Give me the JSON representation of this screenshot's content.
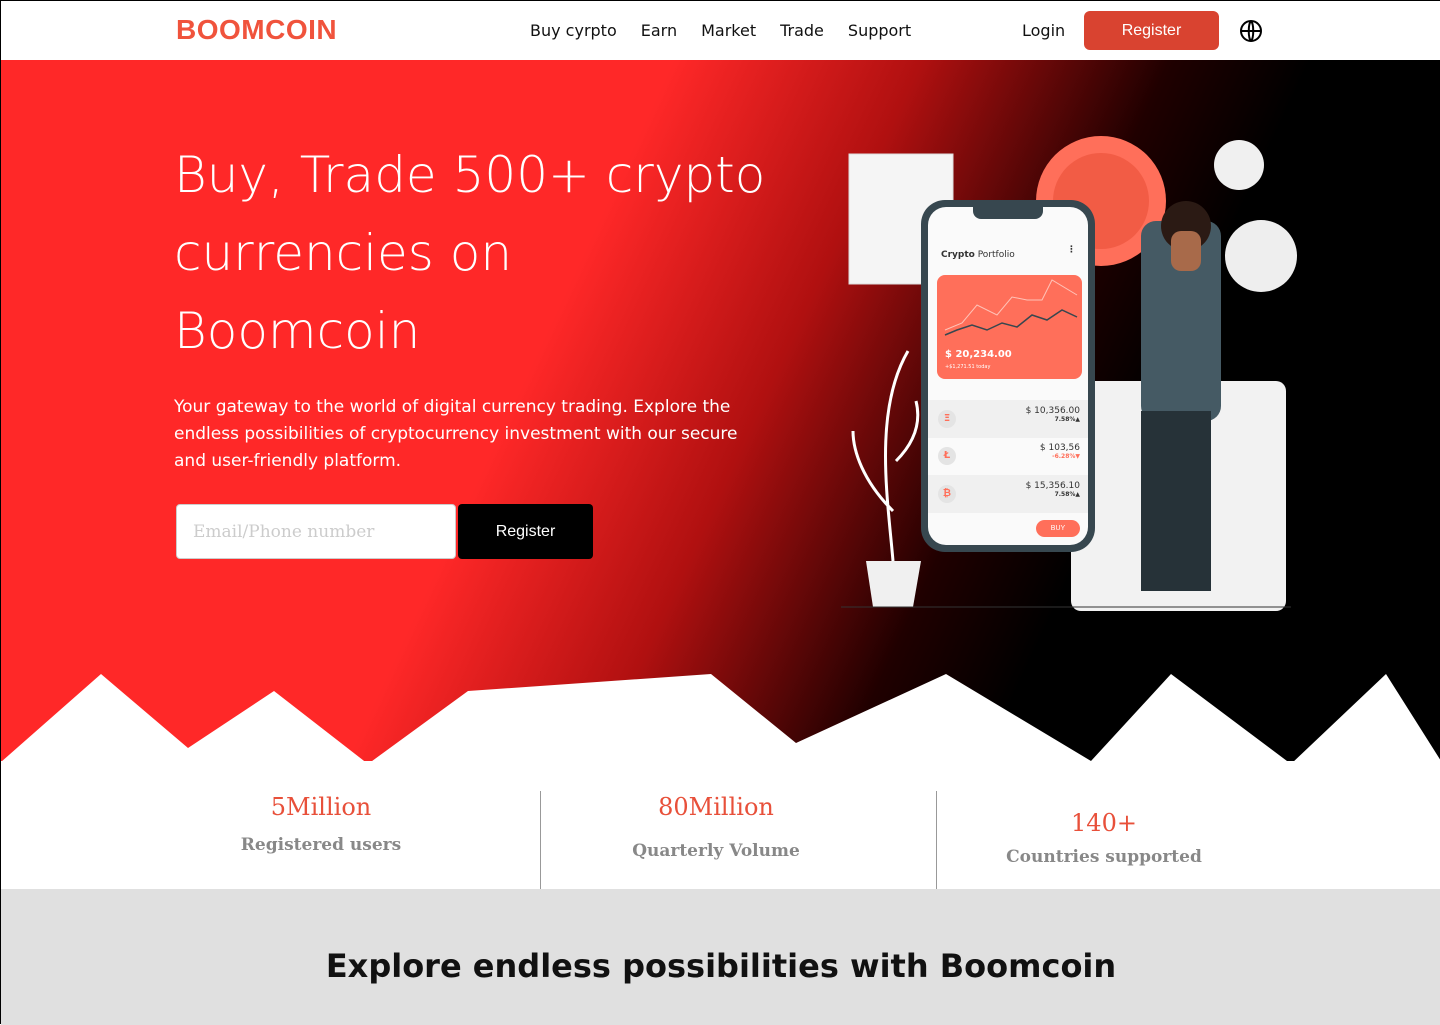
{
  "nav": {
    "logo": "BOOMCOIN",
    "items": [
      "Buy cyrpto",
      "Earn",
      "Market",
      "Trade",
      "Support"
    ],
    "login": "Login",
    "register": "Register"
  },
  "hero": {
    "title": "Buy, Trade 500+ crypto currencies on Boomcoin",
    "subtitle": "Your gateway to the world of digital currency trading. Explore the endless possibilities of cryptocurrency investment with our secure and user-friendly platform.",
    "email_placeholder": "Email/Phone number",
    "register": "Register"
  },
  "phone": {
    "title_bold": "Crypto",
    "title_rest": " Portfolio",
    "balance": "$ 20,234.00",
    "today": "+$1,271.51 today",
    "rows": [
      {
        "coin": "Ξ",
        "amount": "$ 10,356.00",
        "change": "7.58%▲"
      },
      {
        "coin": "Ł",
        "amount": "$ 103,56",
        "change": "-6.28%▼"
      },
      {
        "coin": "₿",
        "amount": "$ 15,356.10",
        "change": "7.58%▲"
      }
    ],
    "buy": "BUY"
  },
  "stats": [
    {
      "value": "5Million",
      "label": "Registered users"
    },
    {
      "value": "80Million",
      "label": "Quarterly Volume"
    },
    {
      "value": "140+",
      "label": "Countries supported"
    }
  ],
  "explore": "Explore endless possibilities with Boomcoin",
  "colors": {
    "brand": "#f0533c",
    "button": "#d94330",
    "hero_red": "#ff2828"
  }
}
